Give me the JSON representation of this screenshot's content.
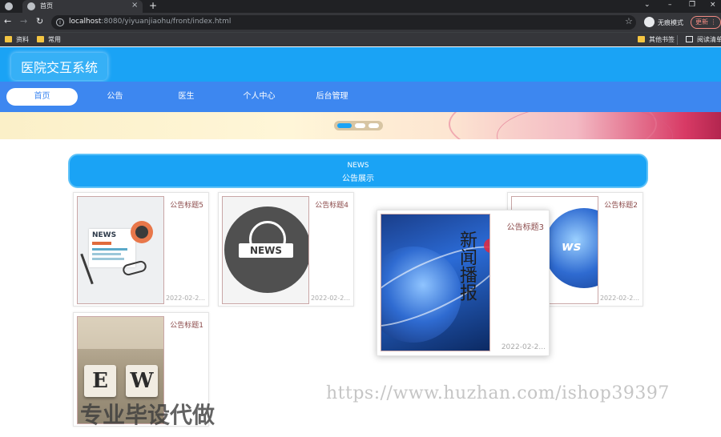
{
  "browser": {
    "tab_title": "首页",
    "url_host": "localhost",
    "url_rest": ":8080/yiyuanjiaohu/front/index.html",
    "incognito_label": "无痕模式",
    "update_label": "更新",
    "bookmarks": [
      "资料",
      "常用",
      "其他书签",
      "阅读清单"
    ]
  },
  "site": {
    "title": "医院交互系统",
    "nav": [
      "首页",
      "公告",
      "医生",
      "个人中心",
      "后台管理"
    ],
    "active_nav": "首页"
  },
  "news_section": {
    "heading_en": "NEWS",
    "heading_cn": "公告展示"
  },
  "cards": [
    {
      "title": "公告标题5",
      "date": "2022-02-2...",
      "image": "newspaper-coffee"
    },
    {
      "title": "公告标题4",
      "date": "2022-02-2...",
      "image": "news-globe-icon"
    },
    {
      "title": "公告标题3",
      "date": "2022-02-2...",
      "image": "earth-news-broadcast",
      "image_text": "新闻播报",
      "hovered": true
    },
    {
      "title": "公告标题2",
      "date": "2022-02-2...",
      "image": "earth-news",
      "image_text": "ws"
    },
    {
      "title": "公告标题1",
      "date": "",
      "image": "letter-blocks",
      "image_text": "EW"
    }
  ],
  "watermark": {
    "url": "https://www.huzhan.com/ishop39397",
    "text": "专业毕设代做"
  },
  "colors": {
    "header": "#1aa3f5",
    "navbar": "#3d87f0",
    "card_title": "#8b4a4a"
  }
}
